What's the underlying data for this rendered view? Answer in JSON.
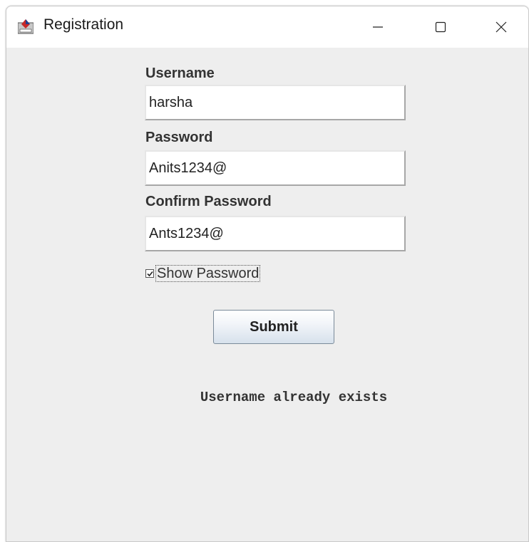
{
  "window": {
    "title": "Registration",
    "icon": "java-app-icon",
    "controls": [
      "minimize-icon",
      "maximize-icon",
      "close-icon"
    ]
  },
  "form": {
    "username_label": "Username",
    "username_value": "harsha",
    "password_label": "Password",
    "password_value": "Anits1234@",
    "confirm_label": "Confirm Password",
    "confirm_value": "Ants1234@",
    "show_password_label": "Show Password",
    "show_password_checked": true,
    "submit_label": "Submit"
  },
  "status": {
    "message": "Username already exists"
  }
}
